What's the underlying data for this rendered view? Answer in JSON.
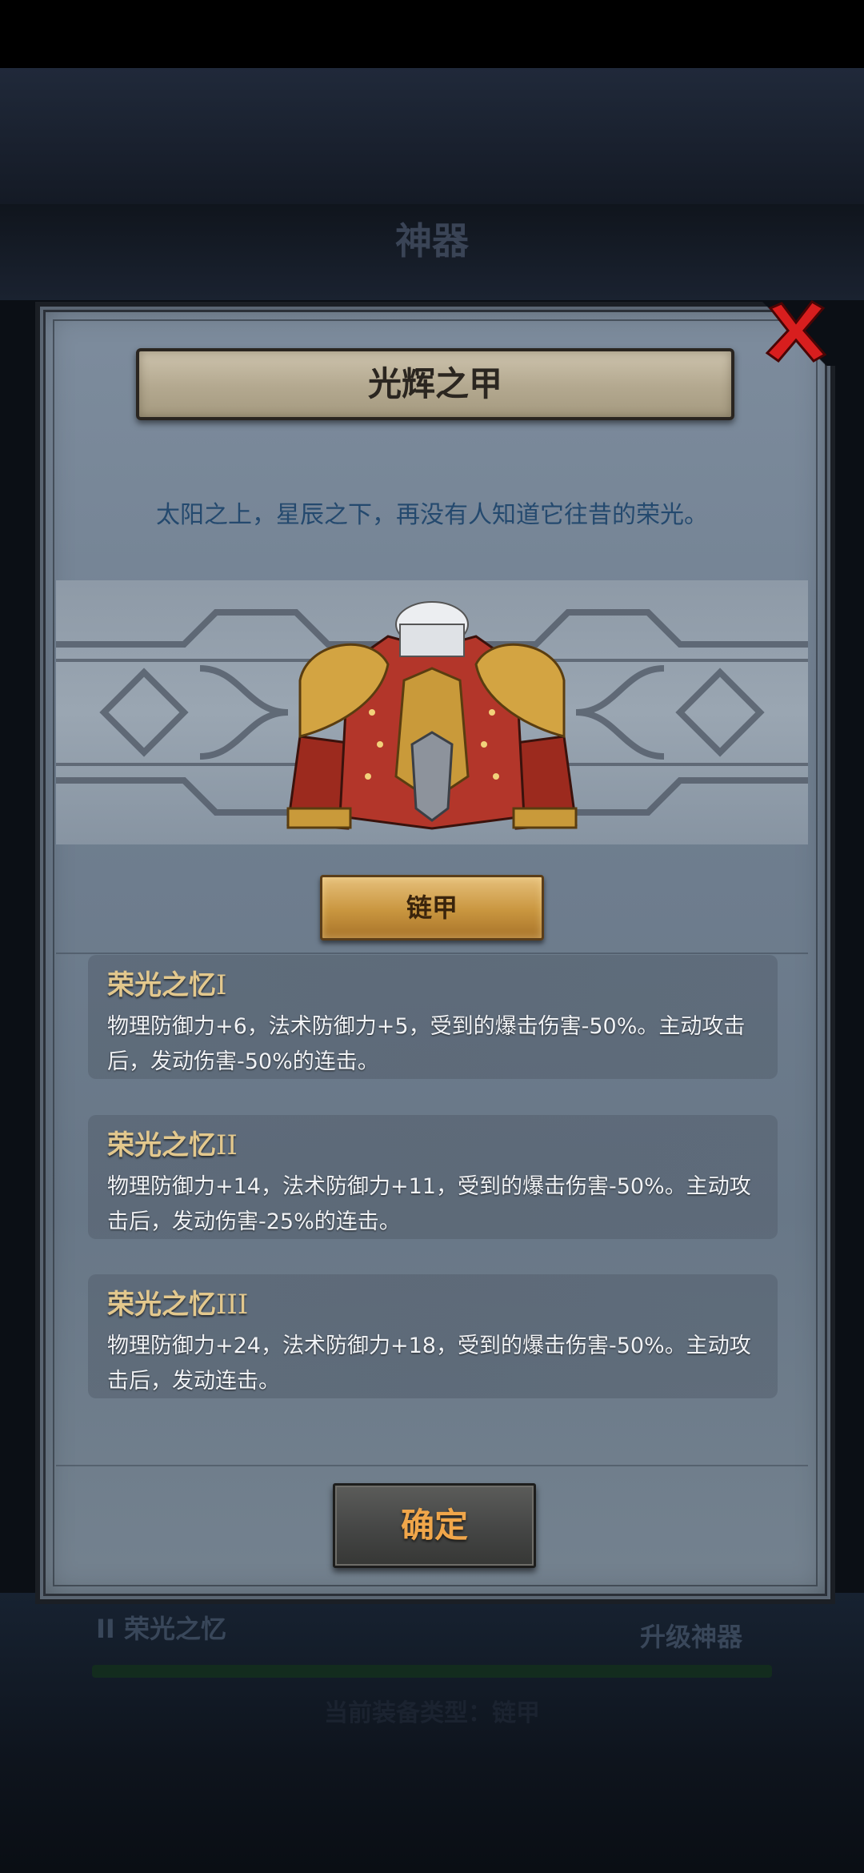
{
  "background": {
    "header_title": "神器",
    "lower_left_text": "II 荣光之忆",
    "lower_right_text": "升级神器",
    "lower_caption": "当前装备类型：链甲"
  },
  "dialog": {
    "title": "光辉之甲",
    "flavor_text": "太阳之上，星辰之下，再没有人知道它往昔的荣光。",
    "item_icon": "armor-chestplate-icon",
    "type_tag": "链甲",
    "skills": [
      {
        "name": "荣光之忆",
        "level": "I",
        "description": "物理防御力+6，法术防御力+5，受到的爆击伤害-50%。主动攻击后，发动伤害-50%的连击。"
      },
      {
        "name": "荣光之忆",
        "level": "II",
        "description": "物理防御力+14，法术防御力+11，受到的爆击伤害-50%。主动攻击后，发动伤害-25%的连击。"
      },
      {
        "name": "荣光之忆",
        "level": "III",
        "description": "物理防御力+24，法术防御力+18，受到的爆击伤害-50%。主动攻击后，发动连击。"
      }
    ],
    "confirm_label": "确定"
  },
  "colors": {
    "panel": "#74828f",
    "skill_title": "#e3c88d",
    "flavor_text": "#24496e",
    "confirm_text": "#f0a64a",
    "close_x": "#d81e1e"
  }
}
